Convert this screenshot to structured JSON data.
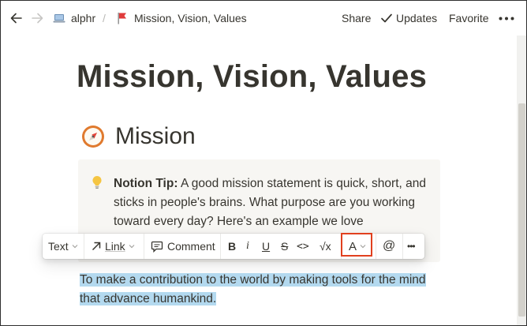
{
  "topbar": {
    "breadcrumb": [
      {
        "icon": "laptop-icon",
        "label": "alphr"
      },
      {
        "icon": "red-flag-icon",
        "label": "Mission, Vision, Values"
      }
    ],
    "separator": "/",
    "share_label": "Share",
    "updates_label": "Updates",
    "favorite_label": "Favorite"
  },
  "page": {
    "title": "Mission, Vision, Values",
    "heading": "Mission",
    "heading_icon": "compass-icon",
    "callout": {
      "icon": "lightbulb-icon",
      "bold": "Notion Tip:",
      "text": " A good mission statement is quick, short, and sticks in people's brains. What purpose are you working toward every day? Here's an example we love"
    },
    "selected_text": "To make a contribution to the world by making tools for the mind that advance humankind."
  },
  "toolbar": {
    "text_label": "Text",
    "link_label": "Link",
    "comment_label": "Comment",
    "bold_label": "B",
    "italic_label": "i",
    "underline_label": "U",
    "strike_label": "S",
    "code_label": "<>",
    "equation_label": "√x",
    "color_label": "A",
    "mention_label": "@",
    "more_label": "•••"
  },
  "colors": {
    "highlight": "#b3d9ef",
    "callout_bg": "#f7f6f3",
    "annotation_box": "#e1401e",
    "text": "#37352f"
  }
}
